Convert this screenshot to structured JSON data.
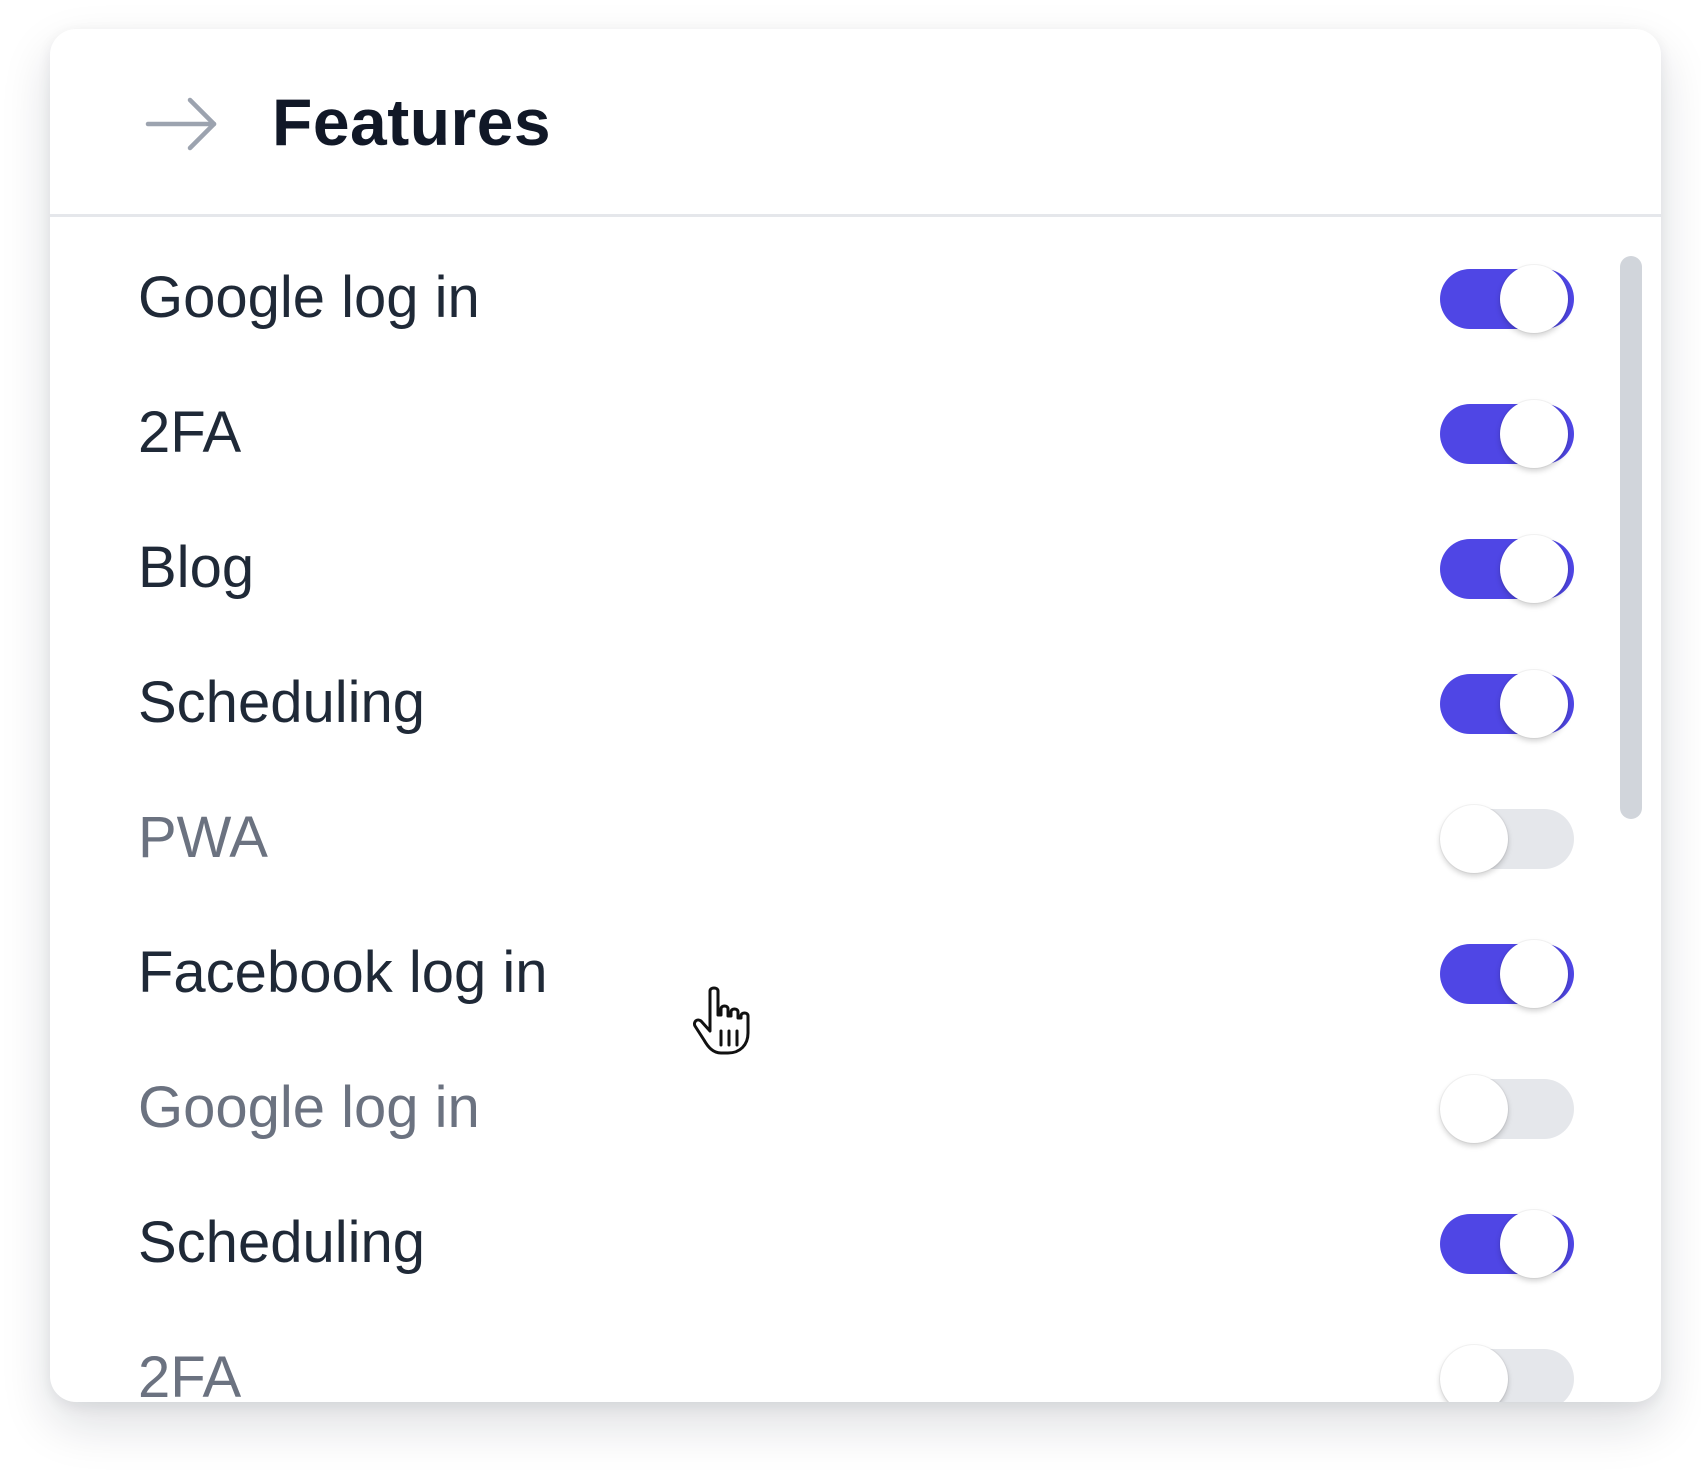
{
  "header": {
    "title": "Features",
    "back_icon": "arrow-right-icon"
  },
  "colors": {
    "toggle_on": "#4f46e5",
    "toggle_off": "#e5e7eb",
    "label_on": "#1f2937",
    "label_off": "#6b7280",
    "title": "#111827"
  },
  "features": [
    {
      "label": "Google log in",
      "enabled": true
    },
    {
      "label": "2FA",
      "enabled": true
    },
    {
      "label": "Blog",
      "enabled": true
    },
    {
      "label": "Scheduling",
      "enabled": true
    },
    {
      "label": "PWA",
      "enabled": false
    },
    {
      "label": "Facebook log in",
      "enabled": true
    },
    {
      "label": "Google log in",
      "enabled": false
    },
    {
      "label": "Scheduling",
      "enabled": true
    },
    {
      "label": "2FA",
      "enabled": false
    }
  ],
  "cursor": "hand-pointer-icon"
}
